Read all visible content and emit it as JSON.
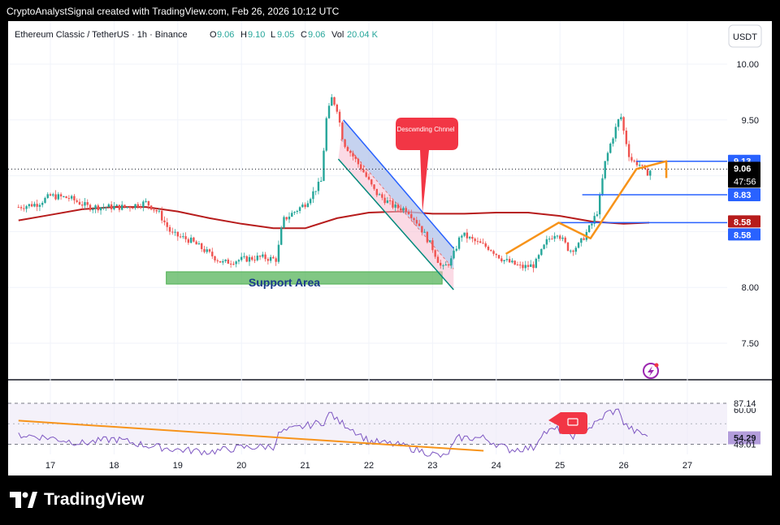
{
  "header": {
    "caption": "CryptoAnalystSignal created with TradingView.com, Feb 26, 2026 10:12 UTC"
  },
  "symbol": {
    "name": "Ethereum Classic / TetherUS · 1h · Binance",
    "o_label": "O",
    "o_value": "9.06",
    "h_label": "H",
    "h_value": "9.10",
    "l_label": "L",
    "l_value": "9.05",
    "c_label": "C",
    "c_value": "9.06",
    "vol_label": "Vol",
    "vol_value": "20.04 K"
  },
  "currency_button": "USDT",
  "price_badges": {
    "level_913": "9.13",
    "last_price": "9.06",
    "countdown": "47:56",
    "level_883": "8.83",
    "ma_value": "8.58",
    "level_858": "8.58"
  },
  "rsi_badges": {
    "upper": "87.14",
    "current": "54.29",
    "lower": "49.01",
    "hidden_band": "60.00"
  },
  "annotations": {
    "support": "Support Area",
    "channel": "Descwnding Chnnel"
  },
  "brand": {
    "name": "TradingView"
  },
  "colors": {
    "bull": "#26a69a",
    "bear": "#ef5350",
    "ma": "#b71c1c",
    "channel": "#2962ff",
    "orange": "#f7931a",
    "support": "#4caf50",
    "rsi": "#7e57c2",
    "callout": "#f23645"
  },
  "chart_data": {
    "type": "candlestick",
    "title": "Ethereum Classic / TetherUS · 1h · Binance",
    "x_ticks": [
      "17",
      "18",
      "19",
      "20",
      "21",
      "22",
      "23",
      "24",
      "25",
      "26",
      "27"
    ],
    "y_ticks": [
      "10.00",
      "9.50",
      "9.00",
      "8.50",
      "8.00",
      "7.50"
    ],
    "ylim": [
      7.2,
      10.3
    ],
    "price_path": [
      [
        16.5,
        8.72
      ],
      [
        16.8,
        8.75
      ],
      [
        17.0,
        8.82
      ],
      [
        17.3,
        8.8
      ],
      [
        17.6,
        8.72
      ],
      [
        17.9,
        8.72
      ],
      [
        18.2,
        8.72
      ],
      [
        18.5,
        8.76
      ],
      [
        18.7,
        8.67
      ],
      [
        18.9,
        8.48
      ],
      [
        19.2,
        8.42
      ],
      [
        19.5,
        8.3
      ],
      [
        19.7,
        8.22
      ],
      [
        20.0,
        8.25
      ],
      [
        20.3,
        8.27
      ],
      [
        20.55,
        8.25
      ],
      [
        20.65,
        8.6
      ],
      [
        21.0,
        8.75
      ],
      [
        21.25,
        8.95
      ],
      [
        21.33,
        9.5
      ],
      [
        21.42,
        9.7
      ],
      [
        21.5,
        9.6
      ],
      [
        21.6,
        9.3
      ],
      [
        21.9,
        9.05
      ],
      [
        22.1,
        8.85
      ],
      [
        22.4,
        8.72
      ],
      [
        22.6,
        8.7
      ],
      [
        22.8,
        8.55
      ],
      [
        23.0,
        8.35
      ],
      [
        23.15,
        8.16
      ],
      [
        23.3,
        8.25
      ],
      [
        23.45,
        8.48
      ],
      [
        23.7,
        8.4
      ],
      [
        23.9,
        8.35
      ],
      [
        24.1,
        8.25
      ],
      [
        24.4,
        8.18
      ],
      [
        24.6,
        8.2
      ],
      [
        24.8,
        8.42
      ],
      [
        24.95,
        8.5
      ],
      [
        25.15,
        8.33
      ],
      [
        25.3,
        8.38
      ],
      [
        25.5,
        8.57
      ],
      [
        25.6,
        8.7
      ],
      [
        25.7,
        9.1
      ],
      [
        25.8,
        9.3
      ],
      [
        25.95,
        9.55
      ],
      [
        26.0,
        9.4
      ],
      [
        26.1,
        9.15
      ],
      [
        26.25,
        9.1
      ],
      [
        26.35,
        9.02
      ],
      [
        26.45,
        9.06
      ]
    ],
    "moving_average": [
      [
        16.5,
        8.6
      ],
      [
        17.0,
        8.65
      ],
      [
        17.5,
        8.7
      ],
      [
        18.0,
        8.72
      ],
      [
        18.5,
        8.72
      ],
      [
        19.0,
        8.68
      ],
      [
        19.5,
        8.62
      ],
      [
        20.0,
        8.57
      ],
      [
        20.5,
        8.53
      ],
      [
        21.0,
        8.53
      ],
      [
        21.5,
        8.62
      ],
      [
        22.0,
        8.67
      ],
      [
        22.5,
        8.68
      ],
      [
        23.0,
        8.66
      ],
      [
        23.5,
        8.66
      ],
      [
        24.0,
        8.67
      ],
      [
        24.5,
        8.67
      ],
      [
        25.0,
        8.64
      ],
      [
        25.5,
        8.59
      ],
      [
        26.0,
        8.57
      ],
      [
        26.4,
        8.58
      ]
    ],
    "horizontal_levels": [
      {
        "value": 9.13,
        "from": 26.2,
        "to": 27.6
      },
      {
        "value": 8.83,
        "from": 25.35,
        "to": 27.6
      },
      {
        "value": 8.58,
        "from": 25.0,
        "to": 27.6
      }
    ],
    "support_zone": {
      "x_from": 18.82,
      "x_to": 23.15,
      "y_from": 8.03,
      "y_to": 8.14
    },
    "channel": {
      "upper": [
        [
          21.6,
          9.5
        ],
        [
          23.33,
          8.35
        ]
      ],
      "lower": [
        [
          21.52,
          9.15
        ],
        [
          23.33,
          7.98
        ]
      ]
    },
    "projection": [
      [
        24.15,
        8.3
      ],
      [
        24.98,
        8.58
      ],
      [
        25.48,
        8.44
      ],
      [
        26.2,
        9.06
      ],
      [
        26.67,
        9.13
      ],
      [
        26.67,
        8.98
      ]
    ],
    "rsi": {
      "ylim": [
        20,
        100
      ],
      "values": [
        [
          16.5,
          58
        ],
        [
          17.0,
          55
        ],
        [
          17.5,
          50
        ],
        [
          18.0,
          54
        ],
        [
          18.5,
          48
        ],
        [
          19.0,
          44
        ],
        [
          19.5,
          42
        ],
        [
          20.0,
          46
        ],
        [
          20.5,
          47
        ],
        [
          20.6,
          60
        ],
        [
          21.0,
          66
        ],
        [
          21.3,
          70
        ],
        [
          21.4,
          79
        ],
        [
          21.5,
          71
        ],
        [
          21.7,
          65
        ],
        [
          22.0,
          52
        ],
        [
          22.5,
          48
        ],
        [
          23.0,
          40
        ],
        [
          23.2,
          37
        ],
        [
          23.4,
          55
        ],
        [
          23.8,
          55
        ],
        [
          24.2,
          44
        ],
        [
          24.6,
          46
        ],
        [
          24.7,
          59
        ],
        [
          24.95,
          63
        ],
        [
          25.2,
          57
        ],
        [
          25.45,
          64
        ],
        [
          25.6,
          70
        ],
        [
          25.75,
          79
        ],
        [
          25.95,
          80
        ],
        [
          26.0,
          68
        ],
        [
          26.2,
          60
        ],
        [
          26.4,
          57
        ]
      ],
      "trendline": [
        [
          16.5,
          71
        ],
        [
          23.8,
          43
        ]
      ],
      "levels": [
        87.14,
        49.01
      ],
      "current": 54.29
    }
  }
}
